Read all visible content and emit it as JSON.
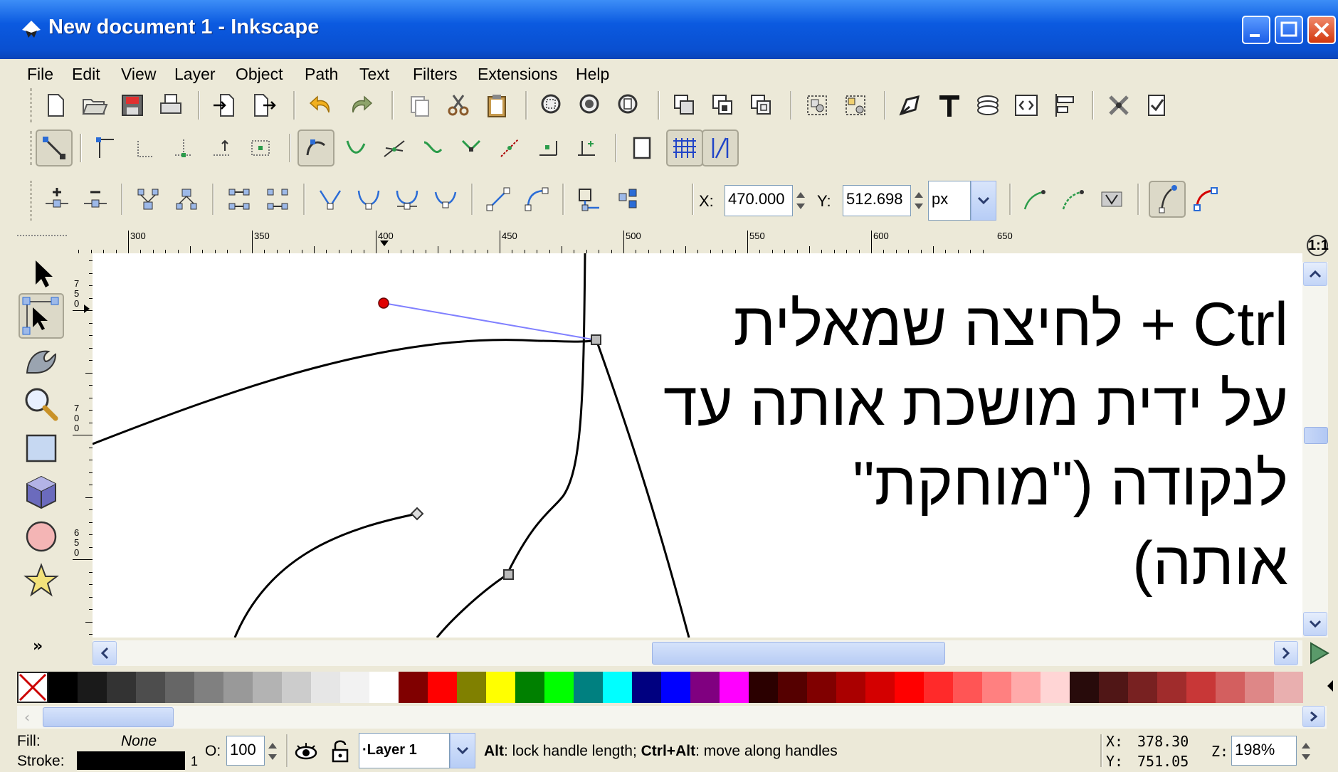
{
  "window": {
    "title": "New document 1 - Inkscape"
  },
  "menu": [
    "File",
    "Edit",
    "View",
    "Layer",
    "Object",
    "Path",
    "Text",
    "Filters",
    "Extensions",
    "Help"
  ],
  "node_toolbar": {
    "x_label": "X:",
    "x_value": "470.000",
    "y_label": "Y:",
    "y_value": "512.698",
    "unit": "px"
  },
  "ruler": {
    "h_labels": [
      "300",
      "350",
      "400",
      "450",
      "500",
      "550",
      "600",
      "650"
    ],
    "v_labels": [
      "750",
      "700",
      "650"
    ]
  },
  "canvas": {
    "overlay_lines": [
      "Ctrl + לחיצה שמאלית",
      "על ידית מושכת אותה עד",
      "לנקודה (\"מוחקת\"",
      "אותה)"
    ]
  },
  "toolbox": {
    "more": "»"
  },
  "zoom_corner": "1:1",
  "status": {
    "fill_label": "Fill:",
    "fill_value": "None",
    "stroke_label": "Stroke:",
    "stroke_width": "1",
    "opacity_label": "O:",
    "opacity_value": "100",
    "layer": "·Layer 1",
    "message_bold1": "Alt",
    "message_text1": ": lock handle length; ",
    "message_bold2": "Ctrl+Alt",
    "message_text2": ": move along handles",
    "x_label": "X:",
    "x_value": "378.30",
    "y_label": "Y:",
    "y_value": "751.05",
    "z_label": "Z:",
    "z_value": "198%"
  },
  "palette_colors": [
    "#000000",
    "#1a1a1a",
    "#333333",
    "#4d4d4d",
    "#666666",
    "#808080",
    "#999999",
    "#b3b3b3",
    "#cccccc",
    "#e6e6e6",
    "#f2f2f2",
    "#ffffff",
    "#800000",
    "#ff0000",
    "#808000",
    "#ffff00",
    "#008000",
    "#00ff00",
    "#008080",
    "#00ffff",
    "#000080",
    "#0000ff",
    "#800080",
    "#ff00ff",
    "#2b0000",
    "#550000",
    "#800000",
    "#aa0000",
    "#d40000",
    "#ff0000",
    "#ff2a2a",
    "#ff5555",
    "#ff8080",
    "#ffaaaa",
    "#ffd5d5",
    "#280b0b",
    "#501616",
    "#782121",
    "#a02c2c",
    "#c83737",
    "#d35f5f",
    "#de8787",
    "#e9afaf"
  ],
  "colors": {
    "title_blue": "#0b5ae0",
    "accent_red": "#d40000",
    "handle_blue": "#8080ff"
  }
}
